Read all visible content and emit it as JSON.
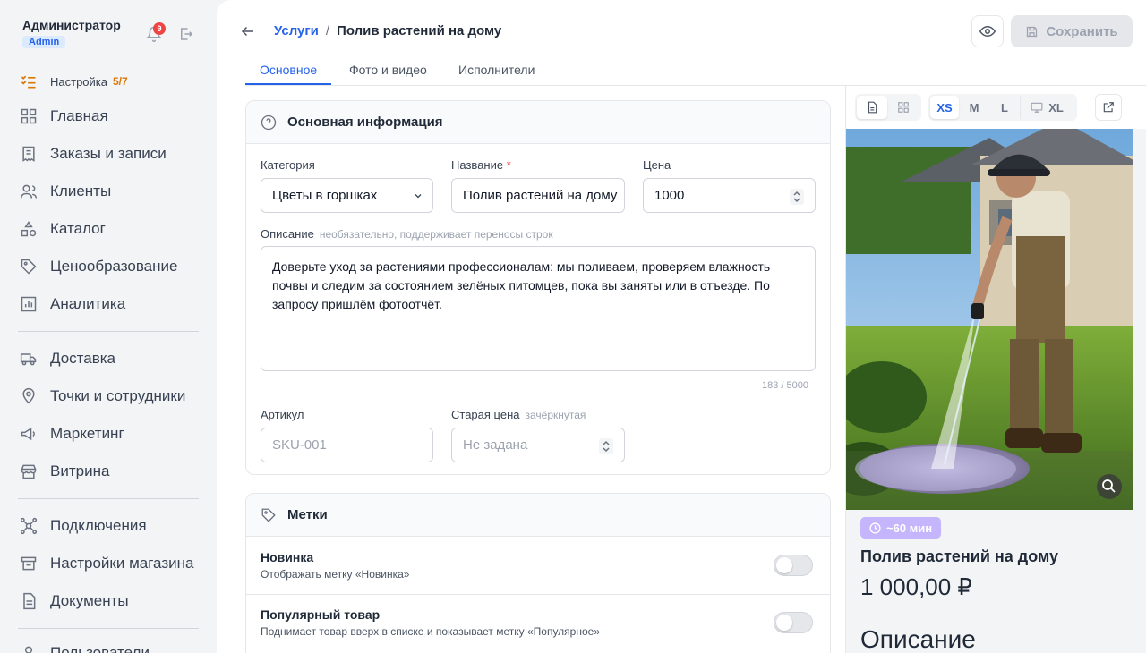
{
  "user": {
    "name": "Администратор",
    "role": "Admin",
    "notifications": "9"
  },
  "sidebar": {
    "setup": {
      "label": "Настройка",
      "progress": "5/7"
    },
    "items": [
      {
        "label": "Главная",
        "icon": "grid-icon"
      },
      {
        "label": "Заказы и записи",
        "icon": "receipt-icon"
      },
      {
        "label": "Клиенты",
        "icon": "users-icon"
      },
      {
        "label": "Каталог",
        "icon": "shapes-icon"
      },
      {
        "label": "Ценообразование",
        "icon": "tag-icon"
      },
      {
        "label": "Аналитика",
        "icon": "chart-icon"
      },
      {
        "label": "Доставка",
        "icon": "truck-icon"
      },
      {
        "label": "Точки и сотрудники",
        "icon": "pin-icon"
      },
      {
        "label": "Маркетинг",
        "icon": "megaphone-icon"
      },
      {
        "label": "Витрина",
        "icon": "store-icon"
      },
      {
        "label": "Подключения",
        "icon": "network-icon"
      },
      {
        "label": "Настройки магазина",
        "icon": "shop-settings-icon"
      },
      {
        "label": "Документы",
        "icon": "document-icon"
      },
      {
        "label": "Пользователи",
        "icon": "user-icon"
      }
    ]
  },
  "header": {
    "breadcrumb_parent": "Услуги",
    "breadcrumb_sep": "/",
    "title": "Полив растений на дому",
    "save_label": "Сохранить"
  },
  "tabs": [
    "Основное",
    "Фото и видео",
    "Исполнители"
  ],
  "basic_info": {
    "title": "Основная информация",
    "category_label": "Категория",
    "category_value": "Цветы в горшках",
    "name_label": "Название",
    "name_required": "*",
    "name_value": "Полив растений на дому",
    "price_label": "Цена",
    "price_value": "1000",
    "description_label": "Описание",
    "description_hint": "необязательно, поддерживает переносы строк",
    "description_value": "Доверьте уход за растениями профессионалам: мы поливаем, проверяем влажность почвы и следим за состоянием зелёных питомцев, пока вы заняты или в отъезде. По запросу пришлём фотоотчёт.",
    "description_counter": "183 / 5000",
    "sku_label": "Артикул",
    "sku_placeholder": "SKU-001",
    "old_price_label": "Старая цена",
    "old_price_hint": "зачёркнутая",
    "old_price_placeholder": "Не задана"
  },
  "tags": {
    "title": "Метки",
    "items": [
      {
        "title": "Новинка",
        "subtitle": "Отображать метку «Новинка»",
        "enabled": false
      },
      {
        "title": "Популярный товар",
        "subtitle": "Поднимает товар вверх в списке и показывает метку «Популярное»",
        "enabled": false
      }
    ]
  },
  "preview": {
    "sizes": [
      "XS",
      "M",
      "L",
      "XL"
    ],
    "active_size": "XS",
    "duration": "~60 мин",
    "title": "Полив растений на дому",
    "price": "1 000,00 ₽",
    "description_heading": "Описание"
  },
  "colors": {
    "accent": "#2563eb",
    "badge": "#ef4444",
    "duration_badge": "#c4b5fd"
  }
}
